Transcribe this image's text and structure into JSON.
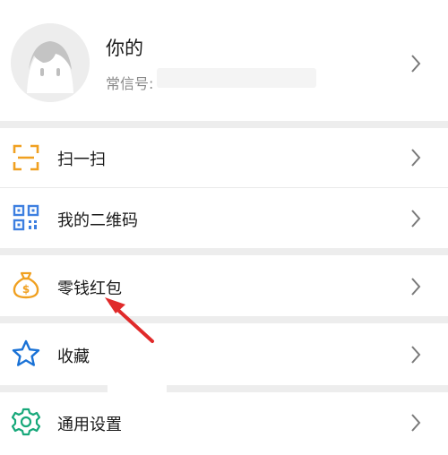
{
  "profile": {
    "name": "你的",
    "id_label": "常信号:",
    "avatar_icon": "default-avatar-icon",
    "chevron_icon": "chevron-right-icon"
  },
  "menu": [
    {
      "label": "扫一扫",
      "icon": "scan-icon",
      "icon_color": "#f0a020"
    },
    {
      "label": "我的二维码",
      "icon": "qr-code-icon",
      "icon_color": "#3d7fe0"
    },
    {
      "label": "零钱红包",
      "icon": "money-bag-icon",
      "icon_color": "#f0a020"
    },
    {
      "label": "收藏",
      "icon": "star-icon",
      "icon_color": "#1a72d6"
    },
    {
      "label": "通用设置",
      "icon": "settings-gear-icon",
      "icon_color": "#17a87a"
    }
  ],
  "annotation": {
    "type": "arrow",
    "color": "#e02a2a"
  }
}
